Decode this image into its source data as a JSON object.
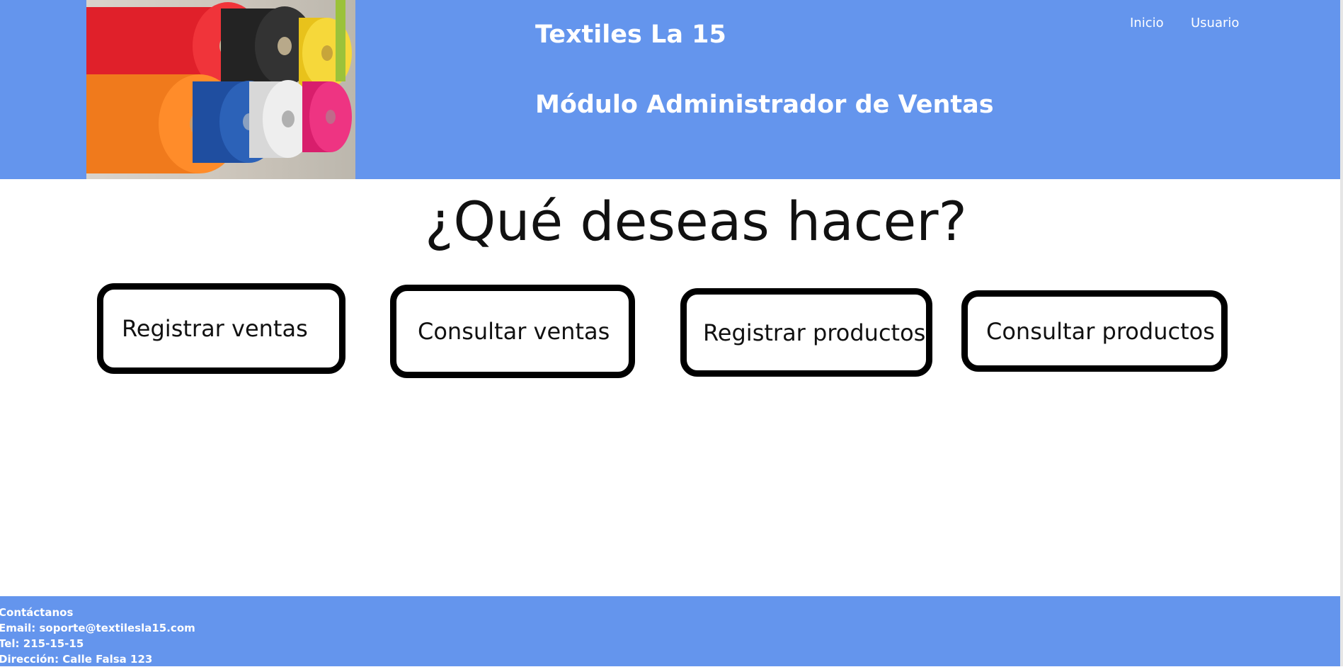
{
  "header": {
    "site_title": "Textiles La 15",
    "module_title": "Módulo Administrador de Ventas",
    "nav": {
      "home": "Inicio",
      "user": "Usuario"
    },
    "hero_image": "fabric-rolls-image"
  },
  "main": {
    "question": "¿Qué deseas hacer?",
    "actions": [
      {
        "label": "Registrar ventas"
      },
      {
        "label": "Consultar ventas"
      },
      {
        "label": "Registrar productos"
      },
      {
        "label": "Consultar productos"
      }
    ]
  },
  "footer": {
    "heading": "Contáctanos",
    "email": "Email: soporte@textilesla15.com",
    "phone": "Tel: 215-15-15",
    "address": "Dirección: Calle Falsa 123"
  },
  "colors": {
    "brand_blue": "#6495ed",
    "text": "#111111",
    "white": "#ffffff"
  }
}
